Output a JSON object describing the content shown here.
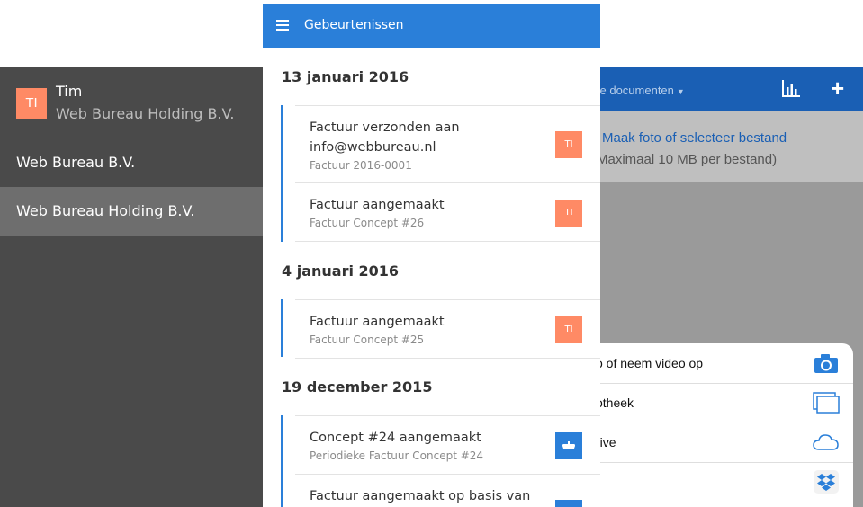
{
  "app": {
    "documents_label": "ve documenten",
    "upload_primary": "Maak foto of selecteer bestand",
    "upload_secondary": "Maximaal 10 MB per bestand)"
  },
  "sheet": {
    "items": [
      {
        "label": "o of neem video op",
        "icon": "camera-icon"
      },
      {
        "label": "otheek",
        "icon": "photo-library-icon"
      },
      {
        "label": "rive",
        "icon": "cloud-icon"
      },
      {
        "label": "",
        "icon": "dropbox-icon"
      }
    ]
  },
  "sidebar": {
    "user": {
      "initials": "TI",
      "name": "Tim",
      "company": "Web Bureau Holding B.V."
    },
    "items": [
      {
        "label": "Web Bureau B.V.",
        "active": false
      },
      {
        "label": "Web Bureau Holding B.V.",
        "active": true
      }
    ]
  },
  "panel": {
    "title": "Gebeurtenissen",
    "groups": [
      {
        "date": "13 januari 2016",
        "events": [
          {
            "title_1": "Factuur verzonden aan",
            "title_2": "info@webbureau.nl",
            "sub": "Factuur 2016-0001",
            "badge": "TI",
            "badge_color": "#ff8a65"
          },
          {
            "title_1": "Factuur aangemaakt",
            "sub": "Factuur Concept #26",
            "badge": "TI",
            "badge_color": "#ff8a65"
          }
        ]
      },
      {
        "date": "4 januari 2016",
        "events": [
          {
            "title_1": "Factuur aangemaakt",
            "sub": "Factuur Concept #25",
            "badge": "TI",
            "badge_color": "#ff8a65"
          }
        ]
      },
      {
        "date": "19 december 2015",
        "events": [
          {
            "title_1": "Concept #24 aangemaakt",
            "sub": "Periodieke Factuur Concept #24",
            "badge_icon": "robot-icon",
            "badge_color": "#2a7fd9"
          },
          {
            "title_1": "Factuur aangemaakt op basis van",
            "badge_color": "#2a7fd9"
          }
        ]
      }
    ]
  },
  "colors": {
    "accent": "#2a7fd9",
    "header_dark": "#1a5fb4",
    "badge_orange": "#ff8a65",
    "sidebar": "#4a4a4a"
  }
}
